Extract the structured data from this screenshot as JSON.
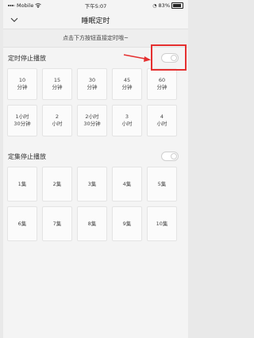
{
  "status": {
    "carrier": "Mobile",
    "time": "下午5:07",
    "battery": "83%"
  },
  "nav": {
    "title": "睡眠定时"
  },
  "hint": "点击下方按钮直接定时哦~",
  "timer_section": {
    "label": "定时停止播放",
    "toggle_on": false,
    "options": [
      {
        "line1": "10",
        "line2": "分钟"
      },
      {
        "line1": "15",
        "line2": "分钟"
      },
      {
        "line1": "30",
        "line2": "分钟"
      },
      {
        "line1": "45",
        "line2": "分钟"
      },
      {
        "line1": "60",
        "line2": "分钟"
      },
      {
        "line1": "1小时",
        "line2": "30分钟"
      },
      {
        "line1": "2",
        "line2": "小时"
      },
      {
        "line1": "2小时",
        "line2": "30分钟"
      },
      {
        "line1": "3",
        "line2": "小时"
      },
      {
        "line1": "4",
        "line2": "小时"
      }
    ]
  },
  "episode_section": {
    "label": "定集停止播放",
    "toggle_on": false,
    "options": [
      "1集",
      "2集",
      "3集",
      "4集",
      "5集",
      "6集",
      "7集",
      "8集",
      "9集",
      "10集"
    ]
  },
  "colors": {
    "highlight": "#e53030",
    "background": "#f4f4f4"
  }
}
